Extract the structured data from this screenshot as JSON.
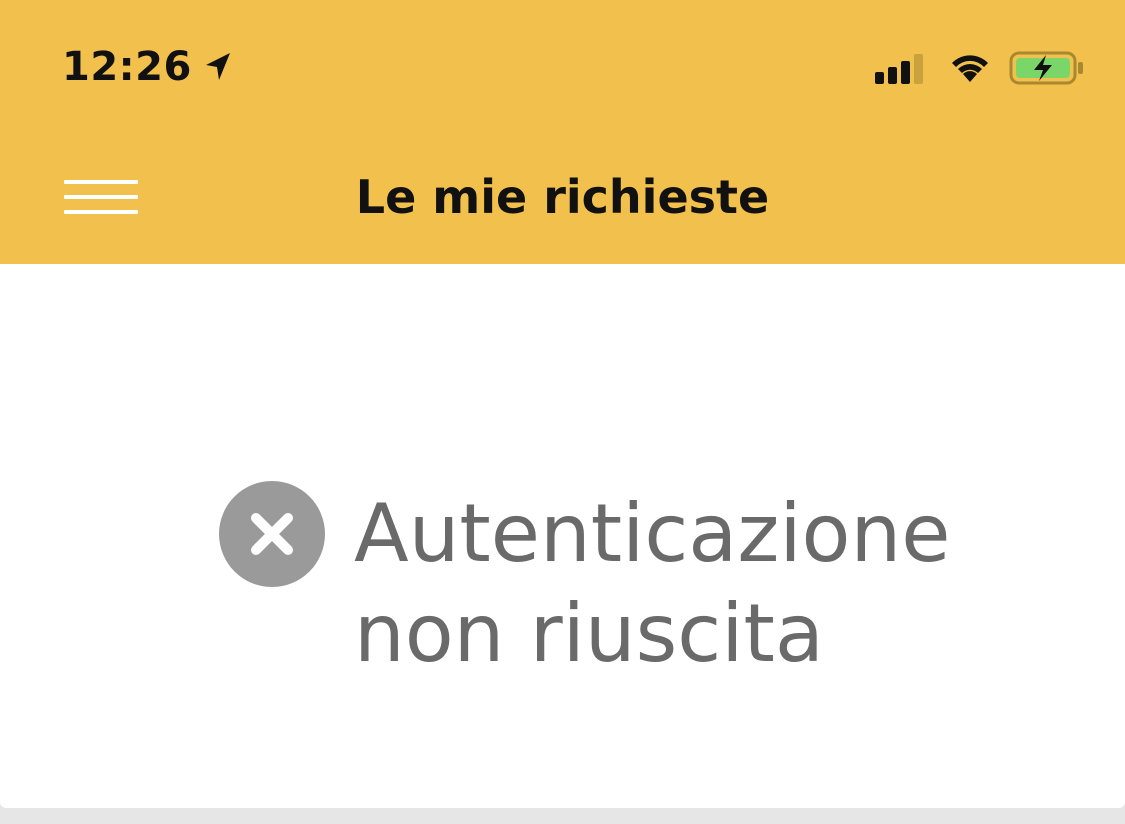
{
  "status_bar": {
    "time": "12:26",
    "location_icon": "location-arrow-icon",
    "signal_icon": "cellular-signal-icon",
    "wifi_icon": "wifi-icon",
    "battery_icon": "battery-charging-icon"
  },
  "nav": {
    "menu_icon": "hamburger-menu-icon",
    "title": "Le mie richieste"
  },
  "content": {
    "error_icon": "close-circle-icon",
    "error_message": "Autenticazione non riuscita"
  },
  "colors": {
    "header_bg": "#f2c04c",
    "card_bg": "#ffffff",
    "page_bg": "#e6e6e6",
    "error_icon": "#9a9a9a",
    "error_text": "#6a6a6a",
    "battery_fill": "#7bd66a"
  }
}
